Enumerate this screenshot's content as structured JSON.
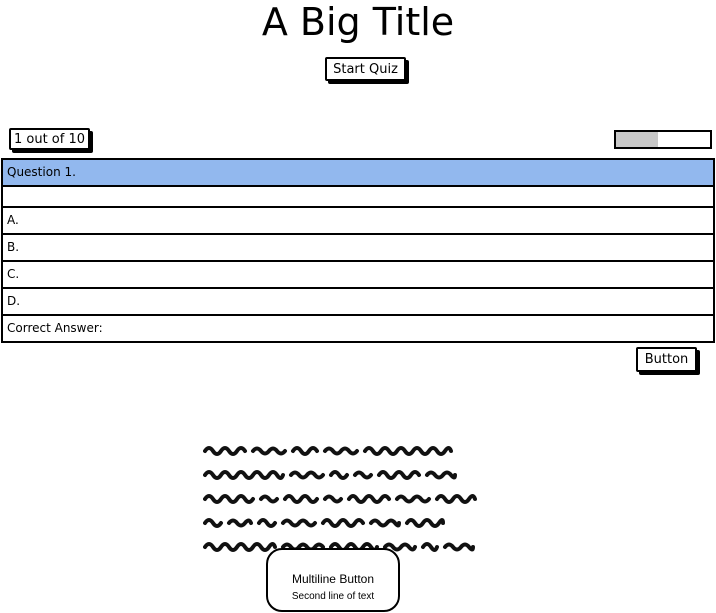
{
  "page": {
    "title": "A Big Title",
    "start_button_label": "Start Quiz",
    "counter_text": "1 out of 10",
    "progress_fraction": 0.45
  },
  "quiz": {
    "question": "Question 1.",
    "question_body": "",
    "options": [
      "A.",
      "B.",
      "C.",
      "D."
    ],
    "correct_answer_label": "Correct Answer:"
  },
  "actions": {
    "button_label": "Button"
  },
  "multiline_button": {
    "line1": "Multiline Button",
    "line2": "Second line of text"
  },
  "colors": {
    "question_header_bg": "#92b8ee",
    "progress_fill": "#c8c8c8"
  }
}
